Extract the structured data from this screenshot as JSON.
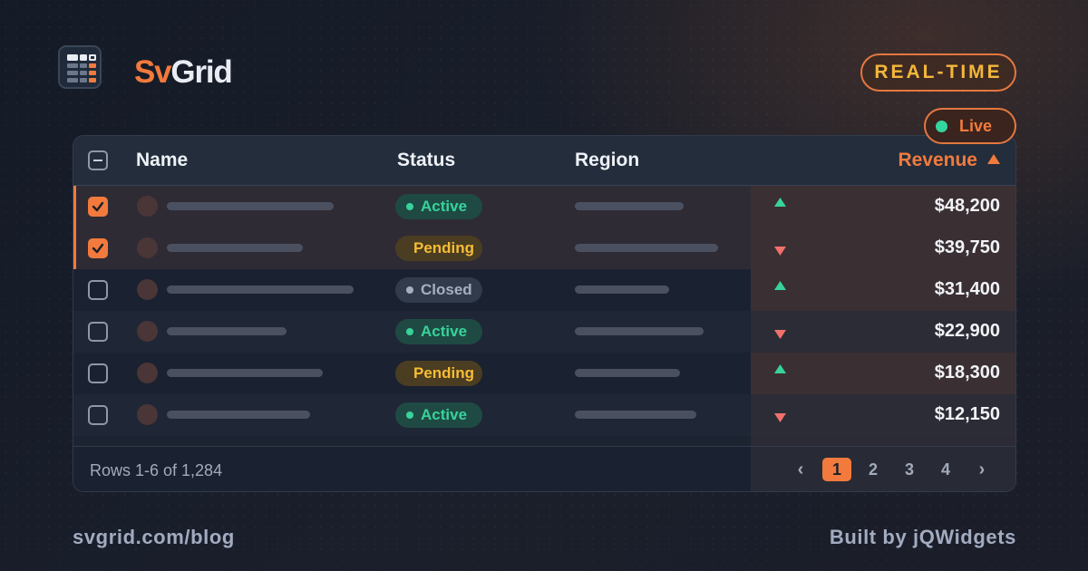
{
  "brand": {
    "prefix": "Sv",
    "suffix": "Grid",
    "logo_icon": "grid-calculator-icon"
  },
  "badges": {
    "realtime": "REAL-TIME",
    "live": "Live",
    "live_color": "#33d69f"
  },
  "table": {
    "columns": {
      "name": "Name",
      "status": "Status",
      "region": "Region",
      "revenue": "Revenue"
    },
    "sort": {
      "column": "revenue",
      "direction": "ascending-indicator",
      "icon": "sort-up-icon"
    },
    "rows": [
      {
        "selected": true,
        "status": "Active",
        "status_kind": "active",
        "revenue": "$48,200",
        "trend": "up"
      },
      {
        "selected": true,
        "status": "Pending",
        "status_kind": "pending",
        "revenue": "$39,750",
        "trend": "down"
      },
      {
        "selected": false,
        "status": "Closed",
        "status_kind": "closed",
        "revenue": "$31,400",
        "trend": "up"
      },
      {
        "selected": false,
        "status": "Active",
        "status_kind": "active",
        "revenue": "$22,900",
        "trend": "down"
      },
      {
        "selected": false,
        "status": "Pending",
        "status_kind": "pending",
        "revenue": "$18,300",
        "trend": "up"
      },
      {
        "selected": false,
        "status": "Active",
        "status_kind": "active",
        "revenue": "$12,150",
        "trend": "down"
      }
    ]
  },
  "footer": {
    "rows_info": "Rows 1-6 of 1,284",
    "pages": [
      "1",
      "2",
      "3",
      "4"
    ],
    "current_page": "1",
    "prev": "‹",
    "next": "›"
  },
  "bottom": {
    "site": "svgrid.com/blog",
    "built_by": "Built by jQWidgets"
  },
  "colors": {
    "accent": "#f27a3d",
    "up": "#37d39a",
    "down": "#f0706a",
    "active": "#37d39a",
    "pending": "#f6bd35",
    "closed": "#a6afbf"
  }
}
